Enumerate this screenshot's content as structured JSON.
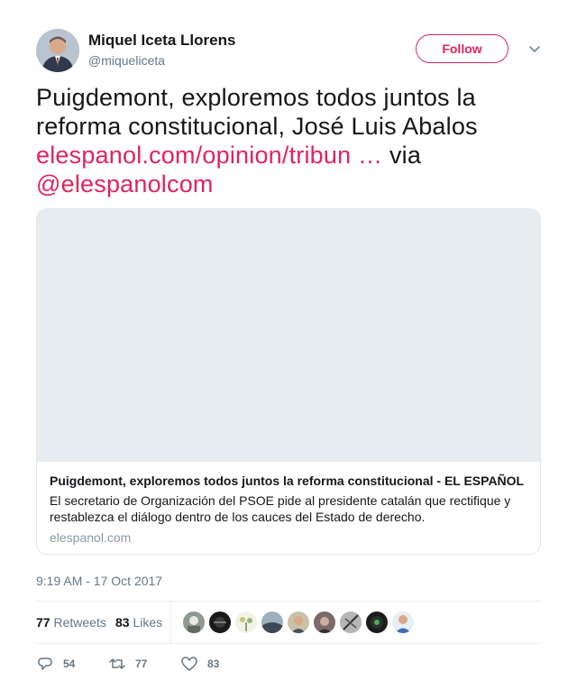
{
  "author": {
    "name": "Miquel Iceta Llorens",
    "handle": "@miqueliceta",
    "follow_label": "Follow"
  },
  "tweet": {
    "text_main": "Puigdemont, exploremos todos juntos la reforma constitucional, José Luis Abalos",
    "link_text": "elespanol.com/opinion/tribun …",
    "via_text": "via",
    "mention": "@elespanolcom"
  },
  "card": {
    "title": "Puigdemont, exploremos todos juntos la reforma constitucional - EL ESPAÑOL",
    "description": "El secretario de Organización del PSOE pide al presidente catalán que rectifique y restablezca el diálogo dentro de los cauces del Estado de derecho.",
    "domain": "elespanol.com"
  },
  "timestamp": "9:19 AM - 17 Oct 2017",
  "stats": {
    "retweets_count": "77",
    "retweets_label": "Retweets",
    "likes_count": "83",
    "likes_label": "Likes"
  },
  "actions": {
    "reply_count": "54",
    "retweet_count": "77",
    "like_count": "83"
  },
  "colors": {
    "accent": "#e0245e",
    "secondary_text": "#657786"
  }
}
